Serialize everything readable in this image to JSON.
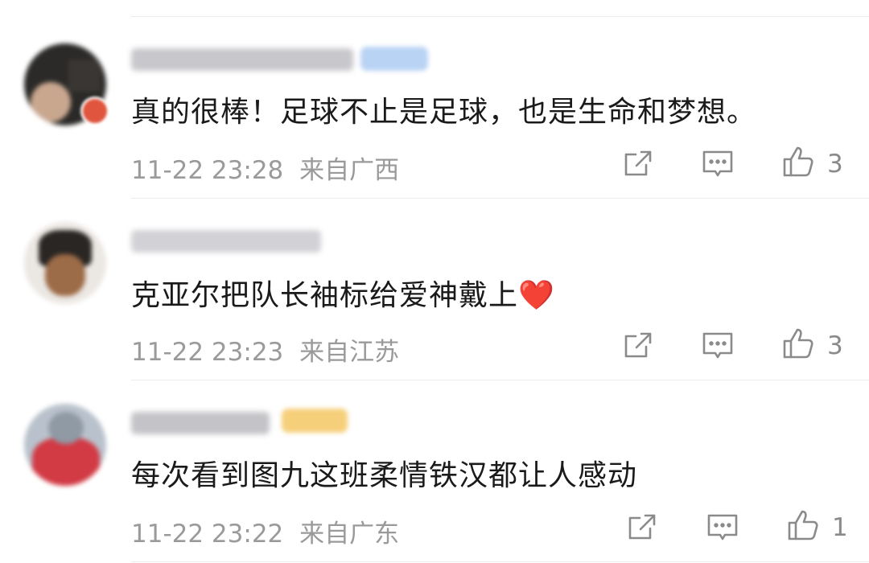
{
  "comments": [
    {
      "text": "真的很棒！足球不止是足球，也是生命和梦想。",
      "time": "11-22 23:28",
      "location": "来自广西",
      "likes": "3"
    },
    {
      "text": "克亚尔把队长袖标给爱神戴上❤️",
      "time": "11-22 23:23",
      "location": "来自江苏",
      "likes": "3"
    },
    {
      "text": "每次看到图九这班柔情铁汉都让人感动",
      "time": "11-22 23:22",
      "location": "来自广东",
      "likes": "1"
    }
  ],
  "icons": {
    "share": "share-icon",
    "reply": "comment-icon",
    "like": "thumbs-up-icon"
  },
  "colors": {
    "text": "#1a1a1a",
    "meta": "#9a9a9a",
    "icon": "#8a8a8a",
    "heart": "#e8322f"
  }
}
